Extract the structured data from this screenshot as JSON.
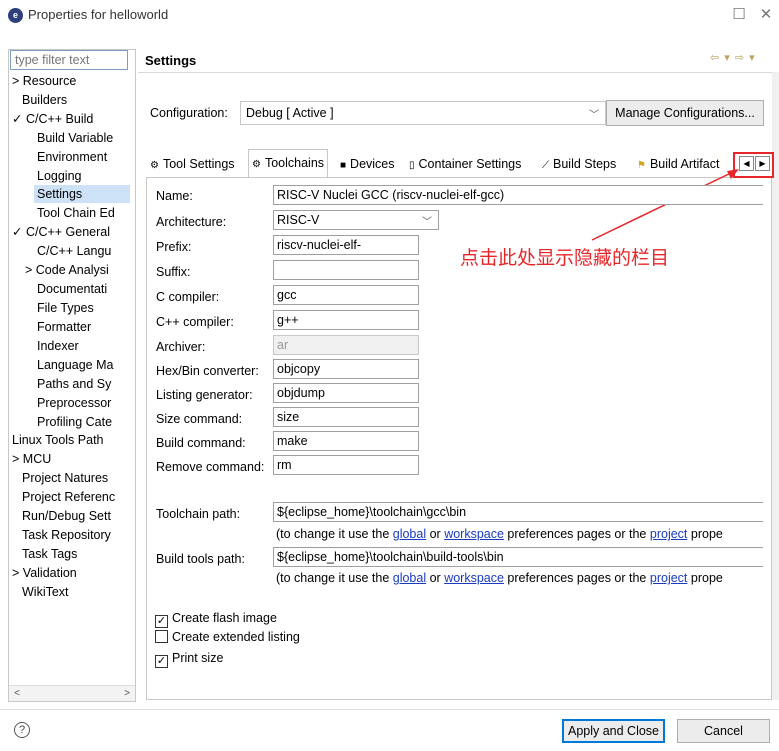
{
  "window": {
    "title": "Properties for helloworld",
    "icon": "eclipse-icon"
  },
  "sidebar": {
    "filter_placeholder": "type filter text",
    "items": [
      {
        "label": "Resource",
        "expander": ">"
      },
      {
        "label": "Builders"
      },
      {
        "label": "C/C++ Build",
        "expander": "v"
      },
      {
        "label": "Build Variable"
      },
      {
        "label": "Environment"
      },
      {
        "label": "Logging"
      },
      {
        "label": "Settings"
      },
      {
        "label": "Tool Chain Ed"
      },
      {
        "label": "C/C++ General",
        "expander": "v"
      },
      {
        "label": "C/C++ Langu"
      },
      {
        "label": "Code Analysi",
        "expander": ">"
      },
      {
        "label": "Documentati"
      },
      {
        "label": "File Types"
      },
      {
        "label": "Formatter"
      },
      {
        "label": "Indexer"
      },
      {
        "label": "Language Ma"
      },
      {
        "label": "Paths and Sy"
      },
      {
        "label": "Preprocessor"
      },
      {
        "label": "Profiling Cate"
      },
      {
        "label": "Linux Tools Path"
      },
      {
        "label": "MCU",
        "expander": ">"
      },
      {
        "label": "Project Natures"
      },
      {
        "label": "Project Referenc"
      },
      {
        "label": "Run/Debug Sett"
      },
      {
        "label": "Task Repository"
      },
      {
        "label": "Task Tags"
      },
      {
        "label": "Validation",
        "expander": ">"
      },
      {
        "label": "WikiText"
      }
    ],
    "selected": "Settings"
  },
  "header": {
    "title": "Settings"
  },
  "configuration": {
    "label": "Configuration:",
    "value": "Debug  [ Active ]",
    "manage_button": "Manage Configurations..."
  },
  "tabs": [
    {
      "label": "Tool Settings"
    },
    {
      "label": "Toolchains",
      "active": true
    },
    {
      "label": "Devices"
    },
    {
      "label": "Container Settings"
    },
    {
      "label": "Build Steps"
    },
    {
      "label": "Build Artifact"
    }
  ],
  "form": {
    "name": {
      "label": "Name:",
      "value": "RISC-V Nuclei GCC (riscv-nuclei-elf-gcc)"
    },
    "architecture": {
      "label": "Architecture:",
      "value": "RISC-V"
    },
    "prefix": {
      "label": "Prefix:",
      "value": "riscv-nuclei-elf-"
    },
    "suffix": {
      "label": "Suffix:",
      "value": ""
    },
    "c_compiler": {
      "label": "C compiler:",
      "value": "gcc"
    },
    "cpp_compiler": {
      "label": "C++ compiler:",
      "value": "g++"
    },
    "archiver": {
      "label": "Archiver:",
      "value": "ar"
    },
    "hexbin": {
      "label": "Hex/Bin converter:",
      "value": "objcopy"
    },
    "listing": {
      "label": "Listing generator:",
      "value": "objdump"
    },
    "size": {
      "label": "Size command:",
      "value": "size"
    },
    "build": {
      "label": "Build command:",
      "value": "make"
    },
    "remove": {
      "label": "Remove command:",
      "value": "rm"
    },
    "toolchain_path": {
      "label": "Toolchain path:",
      "value": "${eclipse_home}\\toolchain\\gcc\\bin"
    },
    "build_tools_path": {
      "label": "Build tools path:",
      "value": "${eclipse_home}\\toolchain\\build-tools\\bin"
    },
    "note": {
      "prefix": "(to change it use the ",
      "global": "global",
      "or": " or ",
      "workspace": "workspace",
      "middle": " preferences pages or the ",
      "project": "project",
      "suffix": " prope"
    }
  },
  "options": [
    {
      "label": "Create flash image",
      "checked": true
    },
    {
      "label": "Create extended listing",
      "checked": false
    },
    {
      "label": "Print size",
      "checked": true
    }
  ],
  "annotation": {
    "text": "点击此处显示隐藏的栏目",
    "color": "#e8262a"
  },
  "footer": {
    "apply": "Apply and Close",
    "cancel": "Cancel"
  }
}
